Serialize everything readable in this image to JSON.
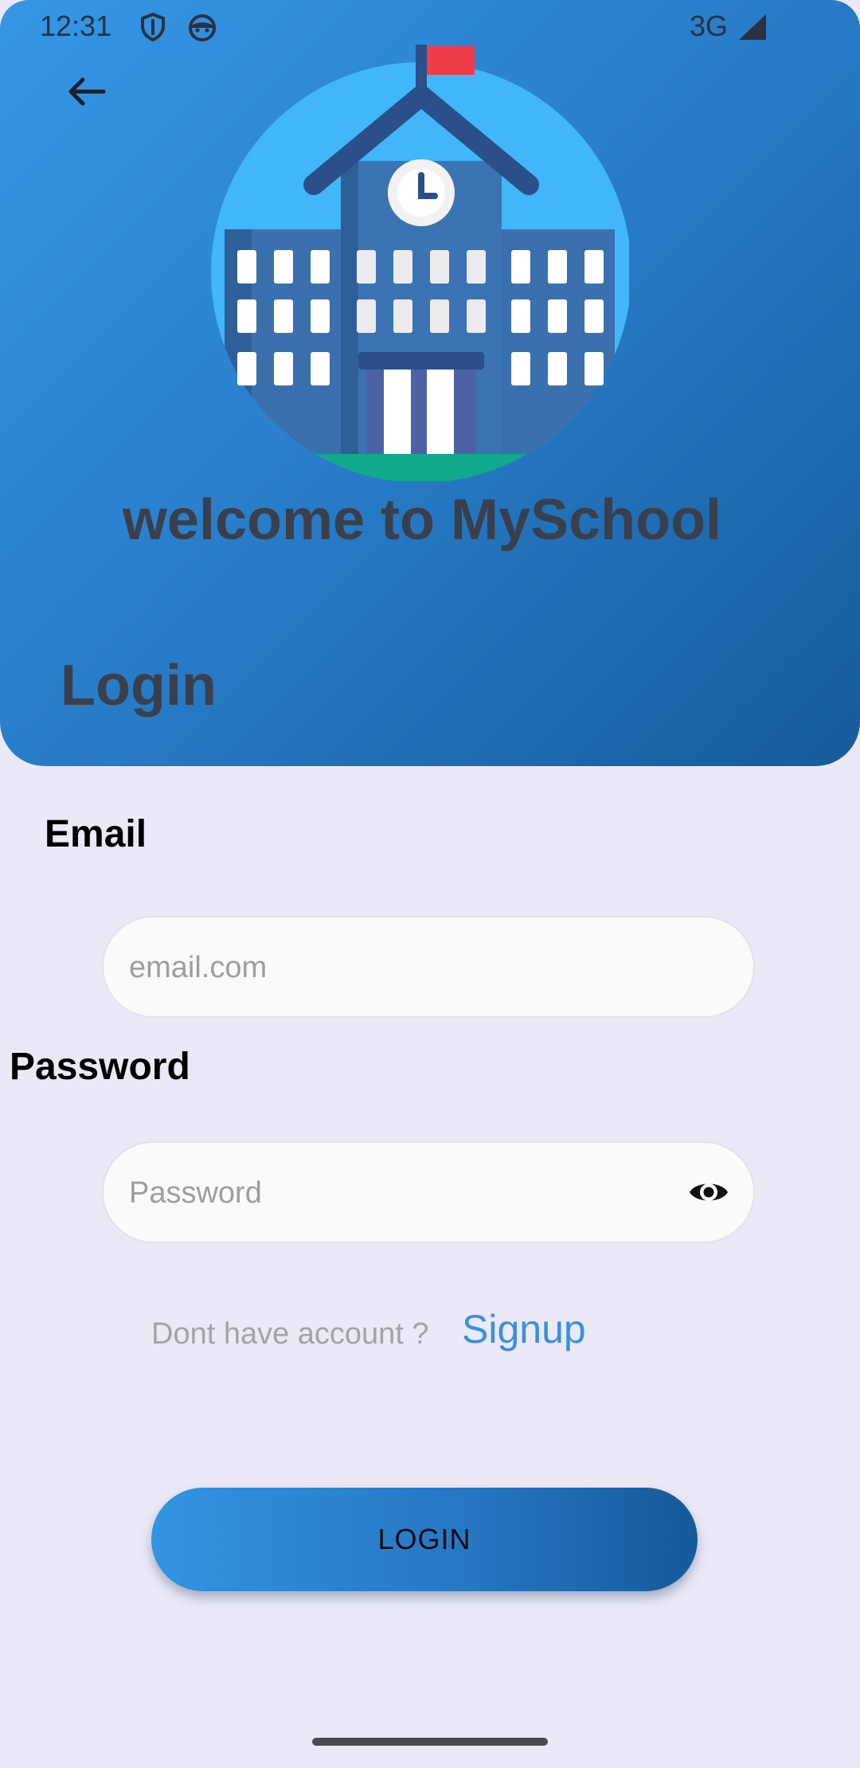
{
  "status_bar": {
    "time": "12:31",
    "network": "3G",
    "icons": [
      "shield-icon",
      "android-icon",
      "signal-icon"
    ]
  },
  "header": {
    "back_icon": "arrow-left-icon",
    "illustration": "school-building-illustration",
    "welcome_title": "welcome to MySchool",
    "login_heading": "Login"
  },
  "form": {
    "email_label": "Email",
    "email_placeholder": "email.com",
    "email_value": "",
    "password_label": "Password",
    "password_placeholder": "Password",
    "password_value": "",
    "password_toggle_icon": "eye-icon"
  },
  "signup": {
    "prompt": "Dont have account ?",
    "link": "Signup"
  },
  "login_button": {
    "label": "LOGIN"
  },
  "colors": {
    "header_gradient_start": "#3497e6",
    "header_gradient_end": "#155c9c",
    "background": "#ebe9f6",
    "link": "#3a8fdc",
    "heading_text": "#3a3f4c"
  }
}
